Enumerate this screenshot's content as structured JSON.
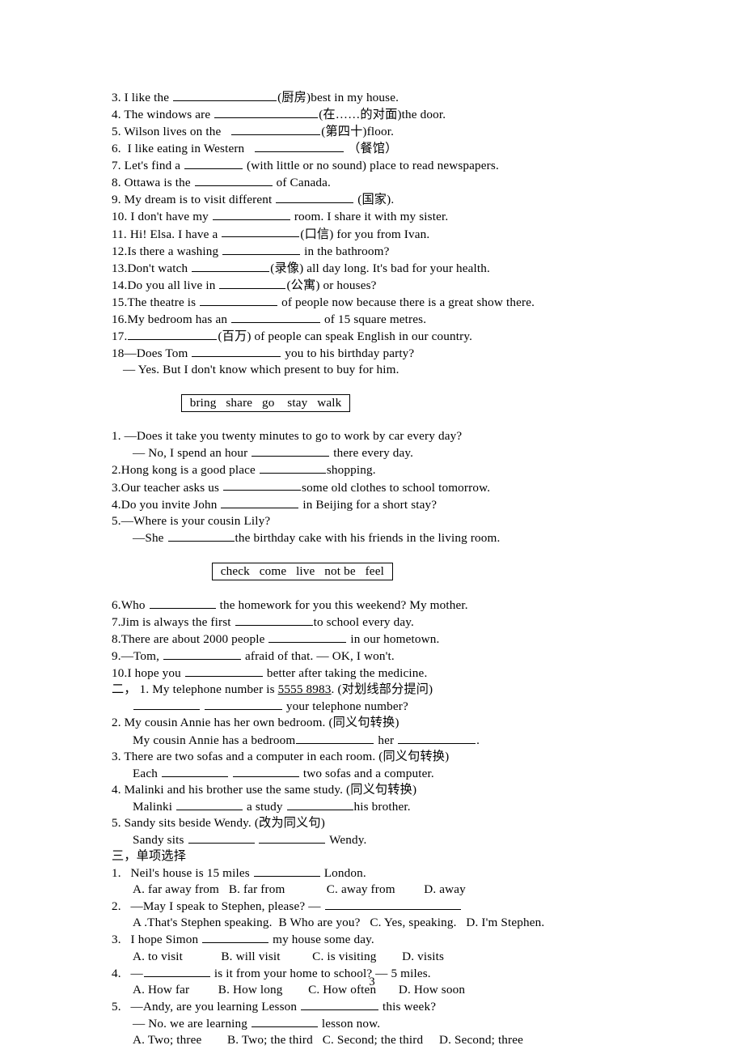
{
  "document": {
    "page_number": "3",
    "section_fill_in": {
      "items": [
        {
          "num": "3. ",
          "pre": "I like the ",
          "blank": "b-xxl",
          "post": "(厨房)best in my house."
        },
        {
          "num": "4. ",
          "pre": "The windows are ",
          "blank": "b-xxl",
          "post": "(在……的对面)the door."
        },
        {
          "num": "5. ",
          "pre": "Wilson lives on the   ",
          "blank": "b-xl",
          "post": "(第四十)floor."
        },
        {
          "num": "6. ",
          "pre": " I like eating in Western   ",
          "blank": "b-xl",
          "post": " （餐馆）"
        },
        {
          "num": "7. ",
          "pre": "Let's find a ",
          "blank": "b-s",
          "post": " (with little or no sound) place to read newspapers."
        },
        {
          "num": "8. ",
          "pre": "Ottawa is the ",
          "blank": "b-l",
          "post": " of Canada."
        },
        {
          "num": "9. ",
          "pre": "My dream is to visit different ",
          "blank": "b-l",
          "post": " (国家)."
        },
        {
          "num": "10. ",
          "pre": "I don't have my ",
          "blank": "b-l",
          "post": " room. I share it with my sister."
        },
        {
          "num": "11. ",
          "pre": "Hi! Elsa. I have a ",
          "blank": "b-l",
          "post": "(口信) for you from Ivan."
        },
        {
          "num": "12.",
          "pre": "Is there a washing ",
          "blank": "b-l",
          "post": " in the bathroom?"
        },
        {
          "num": "13.",
          "pre": "Don't watch ",
          "blank": "b-l",
          "post": "(录像) all day long. It's bad for your health."
        },
        {
          "num": "14.",
          "pre": "Do you all live in ",
          "blank": "b-m",
          "post": "(公寓) or houses?"
        },
        {
          "num": "15.",
          "pre": "The theatre is ",
          "blank": "b-l",
          "post": " of people now because there is a great show there."
        },
        {
          "num": "16.",
          "pre": "My bedroom has an ",
          "blank": "b-xl",
          "post": " of 15 square metres."
        },
        {
          "num": "17.",
          "pre": "",
          "blank": "b-xl",
          "post": "(百万) of people can speak English in our country."
        },
        {
          "num": "18",
          "pre": "—Does Tom ",
          "blank": "b-xl",
          "post": " you to his birthday party?"
        }
      ],
      "answer_line": "— Yes. But I don't know which present to buy for him."
    },
    "word_box_1": {
      "words": "bring   share   go    stay   walk"
    },
    "section_verb_forms_1": {
      "lines": [
        {
          "indent": "",
          "num": "1. ",
          "pre": "—Does it take you twenty minutes to go to work by car every day?",
          "blank": "",
          "post": ""
        },
        {
          "indent": "ind2",
          "num": "",
          "pre": "— No, I spend an hour ",
          "blank": "b-l",
          "post": " there every day."
        },
        {
          "indent": "",
          "num": "2.",
          "pre": "Hong kong is a good place ",
          "blank": "b-m",
          "post": "shopping."
        },
        {
          "indent": "",
          "num": "3.",
          "pre": "Our teacher asks us ",
          "blank": "b-l",
          "post": "some old clothes to school tomorrow."
        },
        {
          "indent": "",
          "num": "4.",
          "pre": "Do you invite John ",
          "blank": "b-l",
          "post": " in Beijing for a short stay?"
        },
        {
          "indent": "",
          "num": "5.",
          "pre": "—Where is your cousin Lily?",
          "blank": "",
          "post": ""
        },
        {
          "indent": "ind2",
          "num": "",
          "pre": "—She ",
          "blank": "b-m",
          "post": "the birthday cake with his friends in the living room."
        }
      ]
    },
    "word_box_2": {
      "words": "check   come   live   not be   feel"
    },
    "section_verb_forms_2": {
      "lines": [
        {
          "num": "6.",
          "pre": "Who ",
          "blank": "b-m",
          "post": " the homework for you this weekend? My mother."
        },
        {
          "num": "7.",
          "pre": "Jim is always the first ",
          "blank": "b-l",
          "post": "to school every day."
        },
        {
          "num": "8.",
          "pre": "There are about 2000 people ",
          "blank": "b-l",
          "post": " in our hometown."
        },
        {
          "num": "9.",
          "pre": "—Tom, ",
          "blank": "b-l",
          "post": " afraid of that. — OK, I won't."
        },
        {
          "num": "10.",
          "pre": "I hope you ",
          "blank": "b-l",
          "post": " better after taking the medicine."
        }
      ]
    },
    "section_two": {
      "marker": "二，",
      "items": [
        {
          "q_indent": "",
          "q_num": " 1. ",
          "q_pre": "My telephone number is ",
          "q_underlined": "5555 8983",
          "q_post": ". (对划线部分提问)",
          "a_indent": "ind2",
          "a_pre": "",
          "a_blank1": "b-m",
          "a_mid": " ",
          "a_blank2": "b-l",
          "a_post": " your telephone number?"
        },
        {
          "q_indent": "",
          "q_num": "2. ",
          "q_pre": "My cousin Annie has her own bedroom. (同义句转换)",
          "q_underlined": "",
          "q_post": "",
          "a_indent": "ind2",
          "a_pre": "My cousin Annie has a bedroom",
          "a_blank1": "b-l",
          "a_mid": " her ",
          "a_blank2": "b-l",
          "a_post": "."
        },
        {
          "q_indent": "",
          "q_num": "3. ",
          "q_pre": "There are two sofas and a computer in each room. (同义句转换)",
          "q_underlined": "",
          "q_post": "",
          "a_indent": "ind2",
          "a_pre": "Each ",
          "a_blank1": "b-m",
          "a_mid": " ",
          "a_blank2": "b-m",
          "a_post": " two sofas and a computer."
        },
        {
          "q_indent": "",
          "q_num": "4. ",
          "q_pre": "Malinki and his brother use the same study. (同义句转换)",
          "q_underlined": "",
          "q_post": "",
          "a_indent": "ind2",
          "a_pre": "Malinki ",
          "a_blank1": "b-m",
          "a_mid": " a study ",
          "a_blank2": "b-m",
          "a_post": "his brother."
        },
        {
          "q_indent": "",
          "q_num": "5. ",
          "q_pre": "Sandy sits beside Wendy. (改为同义句)",
          "q_underlined": "",
          "q_post": "",
          "a_indent": "ind2",
          "a_pre": "Sandy sits ",
          "a_blank1": "b-m",
          "a_mid": " ",
          "a_blank2": "b-m",
          "a_post": " Wendy."
        }
      ]
    },
    "section_three": {
      "heading": "三，单项选择",
      "questions": [
        {
          "num": "1.",
          "stem_pre": "   Neil's house is 15 miles ",
          "stem_blank": "b-m",
          "stem_post": " London.",
          "extra_pre": "",
          "extra_blank": "",
          "extra_post": "",
          "options": "A. far away from   B. far from             C. away from         D. away"
        },
        {
          "num": "2.",
          "stem_pre": "   —May I speak to Stephen, please? — ",
          "stem_blank": "b-huge",
          "stem_post": "",
          "extra_pre": "",
          "extra_blank": "",
          "extra_post": "",
          "options": "A .That's Stephen speaking.  B Who are you?   C. Yes, speaking.   D. I'm Stephen."
        },
        {
          "num": "3.",
          "stem_pre": "   I hope Simon ",
          "stem_blank": "b-m",
          "stem_post": " my house some day.",
          "extra_pre": "",
          "extra_blank": "",
          "extra_post": "",
          "options": "A. to visit            B. will visit          C. is visiting        D. visits"
        },
        {
          "num": "4.",
          "stem_pre": "   —",
          "stem_blank": "b-m",
          "stem_post": " is it from your home to school? — 5 miles.",
          "extra_pre": "",
          "extra_blank": "",
          "extra_post": "",
          "options": "A. How far         B. How long        C. How often       D. How soon"
        },
        {
          "num": "5.",
          "stem_pre": "   —Andy, are you learning Lesson ",
          "stem_blank": "b-l",
          "stem_post": " this week?",
          "extra_pre": "— No. we are learning ",
          "extra_blank": "b-m",
          "extra_post": " lesson now.",
          "options": "A. Two; three        B. Two; the third   C. Second; the third     D. Second; three"
        }
      ]
    }
  }
}
